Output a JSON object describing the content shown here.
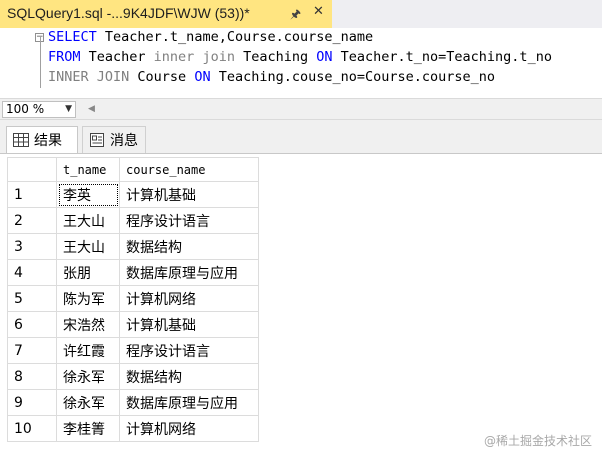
{
  "tab": {
    "title": "SQLQuery1.sql -...9K4JDF\\WJW (53))*",
    "pin_icon": "pin-icon",
    "close_icon": "close-icon"
  },
  "editor": {
    "line1": {
      "kw": "SELECT",
      "rest": " Teacher.t_name,Course.course_name"
    },
    "line2": {
      "kw1": "FROM",
      "t1": " Teacher ",
      "join": "inner join",
      "t2": " Teaching ",
      "kw2": "ON",
      "t3": " Teacher.t_no=Teaching.t_no"
    },
    "line3": {
      "join": "INNER JOIN",
      "t1": " Course ",
      "kw": "ON",
      "t2": " Teaching.couse_no=Course.course_no"
    }
  },
  "zoom": {
    "value": "100 %"
  },
  "result_tabs": [
    {
      "label": "结果",
      "icon": "grid-icon",
      "active": true
    },
    {
      "label": "消息",
      "icon": "message-icon",
      "active": false
    }
  ],
  "grid": {
    "columns": [
      "t_name",
      "course_name"
    ],
    "rows": [
      [
        "1",
        "李英",
        "计算机基础"
      ],
      [
        "2",
        "王大山",
        "程序设计语言"
      ],
      [
        "3",
        "王大山",
        "数据结构"
      ],
      [
        "4",
        "张朋",
        "数据库原理与应用"
      ],
      [
        "5",
        "陈为军",
        "计算机网络"
      ],
      [
        "6",
        "宋浩然",
        "计算机基础"
      ],
      [
        "7",
        "许红霞",
        "程序设计语言"
      ],
      [
        "8",
        "徐永军",
        "数据结构"
      ],
      [
        "9",
        "徐永军",
        "数据库原理与应用"
      ],
      [
        "10",
        "李桂箐",
        "计算机网络"
      ]
    ]
  },
  "watermark": "@稀土掘金技术社区",
  "colors": {
    "active_tab": "#ffe581",
    "keyword": "#0000ff",
    "comment_gray": "#808080"
  }
}
